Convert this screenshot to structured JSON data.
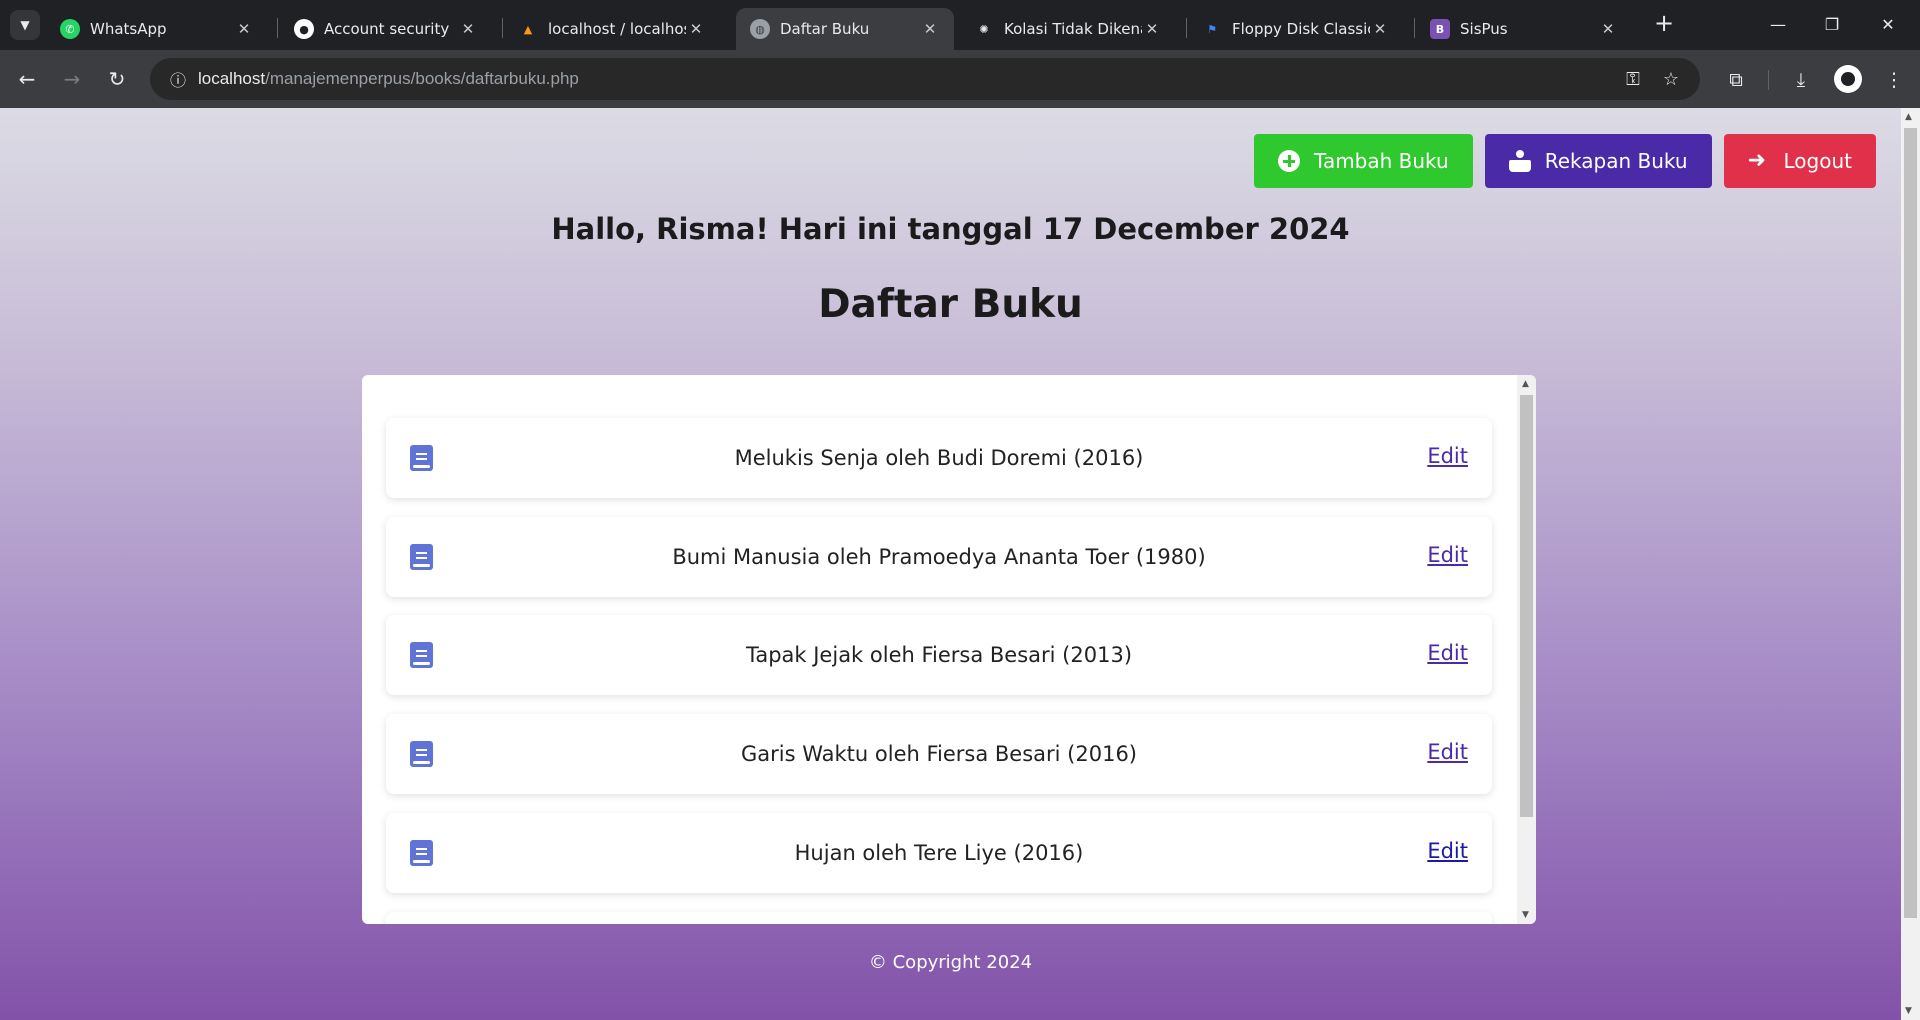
{
  "browser": {
    "tabs": [
      {
        "title": "WhatsApp",
        "icon": "whatsapp-icon",
        "color": "#25d366"
      },
      {
        "title": "Account security",
        "icon": "github-icon",
        "color": "#ffffff"
      },
      {
        "title": "localhost / localhost /",
        "icon": "phpmyadmin-icon",
        "color": "#f89c0e"
      },
      {
        "title": "Daftar Buku",
        "icon": "globe-icon",
        "color": "#9aa0a6"
      },
      {
        "title": "Kolasi Tidak Dikenal I",
        "icon": "openai-icon",
        "color": "#e8eaed"
      },
      {
        "title": "Floppy Disk Classic Li",
        "icon": "flag-icon",
        "color": "#4285f4"
      },
      {
        "title": "SisPus",
        "icon": "bootstrap-icon",
        "color": "#7952b3",
        "letter": "B"
      }
    ],
    "close_glyph": "✕",
    "new_tab_glyph": "+",
    "url_host": "localhost",
    "url_path": "/manajemenperpus/books/daftarbuku.php"
  },
  "page": {
    "actions": {
      "add_label": "Tambah Buku",
      "rekap_label": "Rekapan Buku",
      "logout_label": "Logout"
    },
    "greeting": "Hallo, Risma! Hari ini tanggal 17 December 2024",
    "title": "Daftar Buku",
    "edit_label": "Edit",
    "books": [
      "Melukis Senja oleh Budi Doremi (2016)",
      "Bumi Manusia oleh Pramoedya Ananta Toer (1980)",
      "Tapak Jejak oleh Fiersa Besari (2013)",
      "Garis Waktu oleh Fiersa Besari (2016)",
      "Hujan oleh Tere Liye (2016)"
    ],
    "footer": "© Copyright 2024"
  },
  "colors": {
    "add": "#2fc92f",
    "rekap": "#4b2aa8",
    "logout": "#e0304a",
    "book_icon": "#5f74d6"
  }
}
